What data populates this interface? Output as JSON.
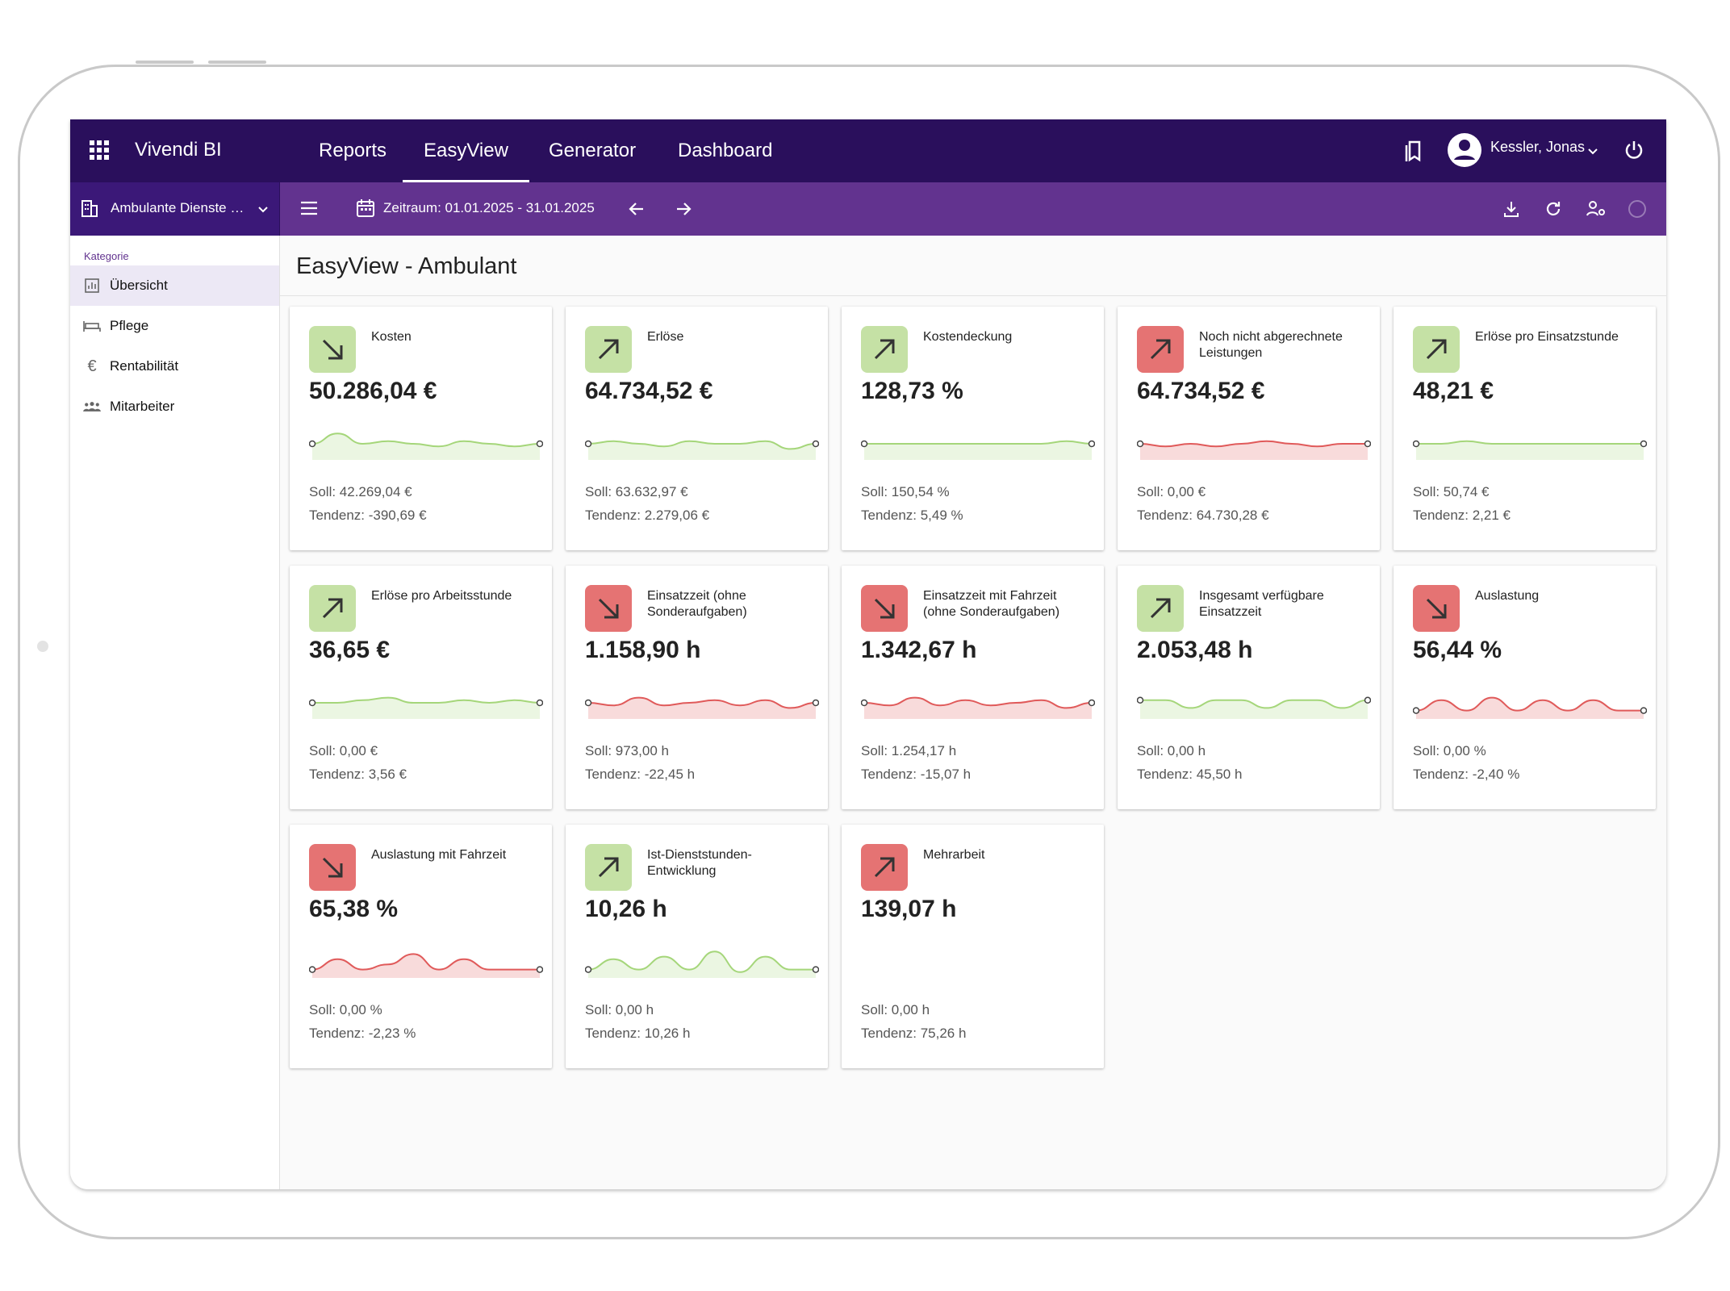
{
  "app": {
    "brand": "Vivendi BI",
    "user": "Kessler, Jonas"
  },
  "nav": {
    "reports": "Reports",
    "easyview": "EasyView",
    "generator": "Generator",
    "dashboard": "Dashboard"
  },
  "toolbar": {
    "org": "Ambulante Dienste P...",
    "period": "Zeitraum: 01.01.2025 - 31.01.2025"
  },
  "sidebar": {
    "category_label": "Kategorie",
    "items": [
      {
        "label": "Übersicht",
        "icon": "chart-icon"
      },
      {
        "label": "Pflege",
        "icon": "bed-icon"
      },
      {
        "label": "Rentabilität",
        "icon": "euro-icon"
      },
      {
        "label": "Mitarbeiter",
        "icon": "people-icon"
      }
    ]
  },
  "page": {
    "title": "EasyView - Ambulant"
  },
  "colors": {
    "topbar": "#2a0f5c",
    "subbar": "#62338f",
    "good": "#c5e1a5",
    "bad": "#e57373",
    "good_line": "#a5d67a",
    "bad_line": "#e05a5a"
  },
  "cards": [
    {
      "title": "Kosten",
      "value": "50.286,04 €",
      "soll": "Soll: 42.269,04 €",
      "tendenz": "Tendenz: -390,69 €",
      "badge": "good",
      "trend": "down"
    },
    {
      "title": "Erlöse",
      "value": "64.734,52 €",
      "soll": "Soll: 63.632,97 €",
      "tendenz": "Tendenz: 2.279,06 €",
      "badge": "good",
      "trend": "up"
    },
    {
      "title": "Kostendeckung",
      "value": "128,73 %",
      "soll": "Soll: 150,54 %",
      "tendenz": "Tendenz: 5,49 %",
      "badge": "good",
      "trend": "up"
    },
    {
      "title": "Noch nicht abgerechnete Leistungen",
      "value": "64.734,52 €",
      "soll": "Soll: 0,00 €",
      "tendenz": "Tendenz: 64.730,28 €",
      "badge": "bad",
      "trend": "up"
    },
    {
      "title": "Erlöse pro Einsatzstunde",
      "value": "48,21 €",
      "soll": "Soll: 50,74 €",
      "tendenz": "Tendenz: 2,21 €",
      "badge": "good",
      "trend": "up"
    },
    {
      "title": "Erlöse pro Arbeitsstunde",
      "value": "36,65 €",
      "soll": "Soll: 0,00 €",
      "tendenz": "Tendenz: 3,56 €",
      "badge": "good",
      "trend": "up"
    },
    {
      "title": "Einsatzzeit (ohne Sonderaufgaben)",
      "value": "1.158,90 h",
      "soll": "Soll: 973,00 h",
      "tendenz": "Tendenz: -22,45 h",
      "badge": "bad",
      "trend": "down"
    },
    {
      "title": "Einsatzzeit mit Fahrzeit (ohne Sonderaufgaben)",
      "value": "1.342,67 h",
      "soll": "Soll: 1.254,17 h",
      "tendenz": "Tendenz: -15,07 h",
      "badge": "bad",
      "trend": "down"
    },
    {
      "title": "Insgesamt verfügbare Einsatzzeit",
      "value": "2.053,48 h",
      "soll": "Soll: 0,00 h",
      "tendenz": "Tendenz: 45,50 h",
      "badge": "good",
      "trend": "up"
    },
    {
      "title": "Auslastung",
      "value": "56,44 %",
      "soll": "Soll: 0,00 %",
      "tendenz": "Tendenz: -2,40 %",
      "badge": "bad",
      "trend": "down"
    },
    {
      "title": "Auslastung mit Fahrzeit",
      "value": "65,38 %",
      "soll": "Soll: 0,00 %",
      "tendenz": "Tendenz: -2,23 %",
      "badge": "bad",
      "trend": "down"
    },
    {
      "title": "Ist-Dienststunden-Entwicklung",
      "value": "10,26 h",
      "soll": "Soll: 0,00 h",
      "tendenz": "Tendenz: 10,26 h",
      "badge": "good",
      "trend": "up"
    },
    {
      "title": "Mehrarbeit",
      "value": "139,07 h",
      "soll": "Soll: 0,00 h",
      "tendenz": "Tendenz: 75,26 h",
      "badge": "bad",
      "trend": "up"
    }
  ]
}
